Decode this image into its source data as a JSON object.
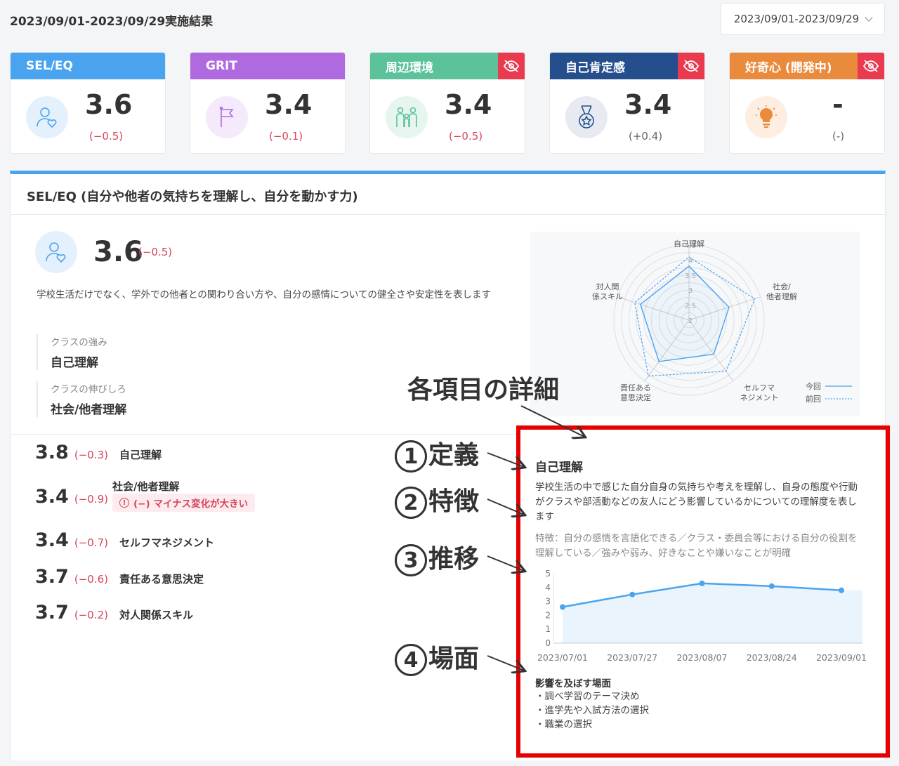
{
  "header": {
    "title": "2023/09/01-2023/09/29実施結果",
    "date_range": "2023/09/01-2023/09/29"
  },
  "cards": [
    {
      "name": "SEL/EQ",
      "score": "3.6",
      "diff": "(−0.5)",
      "color": "#4aa3ef",
      "icon": "person-heart-icon",
      "hidden_toggle": false
    },
    {
      "name": "GRIT",
      "score": "3.4",
      "diff": "(−0.1)",
      "color": "#b06ae0",
      "icon": "flag-icon",
      "hidden_toggle": false
    },
    {
      "name": "周辺環境",
      "score": "3.4",
      "diff": "(−0.5)",
      "color": "#5cc29a",
      "icon": "family-icon",
      "hidden_toggle": true
    },
    {
      "name": "自己肯定感",
      "score": "3.4",
      "diff": "(+0.4)",
      "color": "#244f8c",
      "icon": "medal-icon",
      "hidden_toggle": true
    },
    {
      "name": "好奇心 (開発中)",
      "score": "-",
      "diff": "(-)",
      "color": "#ea8a3c",
      "icon": "lightbulb-icon",
      "hidden_toggle": true
    }
  ],
  "section": {
    "title": "SEL/EQ (自分や他者の気持ちを理解し、自分を動かす力)",
    "score": "3.6",
    "diff": "(−0.5)",
    "description": "学校生活だけでなく、学外での他者との関わり合い方や、自分の感情についての健全さや安定性を表します",
    "strength_label": "クラスの強み",
    "strength_value": "自己理解",
    "growth_label": "クラスの伸びしろ",
    "growth_value": "社会/他者理解"
  },
  "radar": {
    "axes": [
      "自己理解",
      "社会/\n他者理解",
      "セルフマ\nネジメント",
      "責任ある\n意思決定",
      "対人関\n係スキル"
    ],
    "ticks": [
      "2",
      "2.5",
      "3",
      "3.5",
      "4",
      "4.5"
    ],
    "legend_current": "今回",
    "legend_previous": "前回"
  },
  "chart_data": [
    {
      "type": "radar",
      "categories": [
        "自己理解",
        "社会/他者理解",
        "セルフマネジメント",
        "責任ある意思決定",
        "対人関係スキル"
      ],
      "series": [
        {
          "name": "今回",
          "values": [
            3.8,
            3.4,
            3.4,
            3.7,
            3.7
          ]
        },
        {
          "name": "前回",
          "values": [
            4.1,
            4.3,
            4.1,
            4.3,
            3.9
          ]
        }
      ],
      "ylim": [
        2,
        4.5
      ]
    },
    {
      "type": "area",
      "x": [
        "2023/07/01",
        "2023/07/27",
        "2023/08/07",
        "2023/08/24",
        "2023/09/01"
      ],
      "values": [
        2.6,
        3.5,
        4.3,
        4.1,
        3.8
      ],
      "ylim": [
        0,
        5
      ],
      "yticks": [
        "0",
        "1",
        "2",
        "3",
        "4",
        "5"
      ]
    }
  ],
  "rows": [
    {
      "score": "3.8",
      "diff": "(−0.3)",
      "label": "自己理解"
    },
    {
      "score": "3.4",
      "diff": "(−0.9)",
      "label": "社会/他者理解",
      "warning": "(−) マイナス変化が大きい"
    },
    {
      "score": "3.4",
      "diff": "(−0.7)",
      "label": "セルフマネジメント"
    },
    {
      "score": "3.7",
      "diff": "(−0.6)",
      "label": "責任ある意思決定"
    },
    {
      "score": "3.7",
      "diff": "(−0.2)",
      "label": "対人関係スキル"
    }
  ],
  "detail": {
    "title": "自己理解",
    "definition": "学校生活の中で感じた自分自身の気持ちや考えを理解し、自身の態度や行動がクラスや部活動などの友人にどう影響しているかについての理解度を表します",
    "feature": "特徴：自分の感情を言語化できる／クラス・委員会等における自分の役割を理解している／強みや弱み、好きなことや嫌いなことが明確",
    "scene_title": "影響を及ぼす場面",
    "scenes": [
      "・調べ学習のテーマ決め",
      "・進学先や入試方法の選択",
      "・職業の選択"
    ]
  },
  "annotations": {
    "main": "各項目の詳細",
    "items": [
      {
        "num": "1",
        "label": "定義"
      },
      {
        "num": "2",
        "label": "特徴"
      },
      {
        "num": "3",
        "label": "推移"
      },
      {
        "num": "4",
        "label": "場面"
      }
    ]
  }
}
